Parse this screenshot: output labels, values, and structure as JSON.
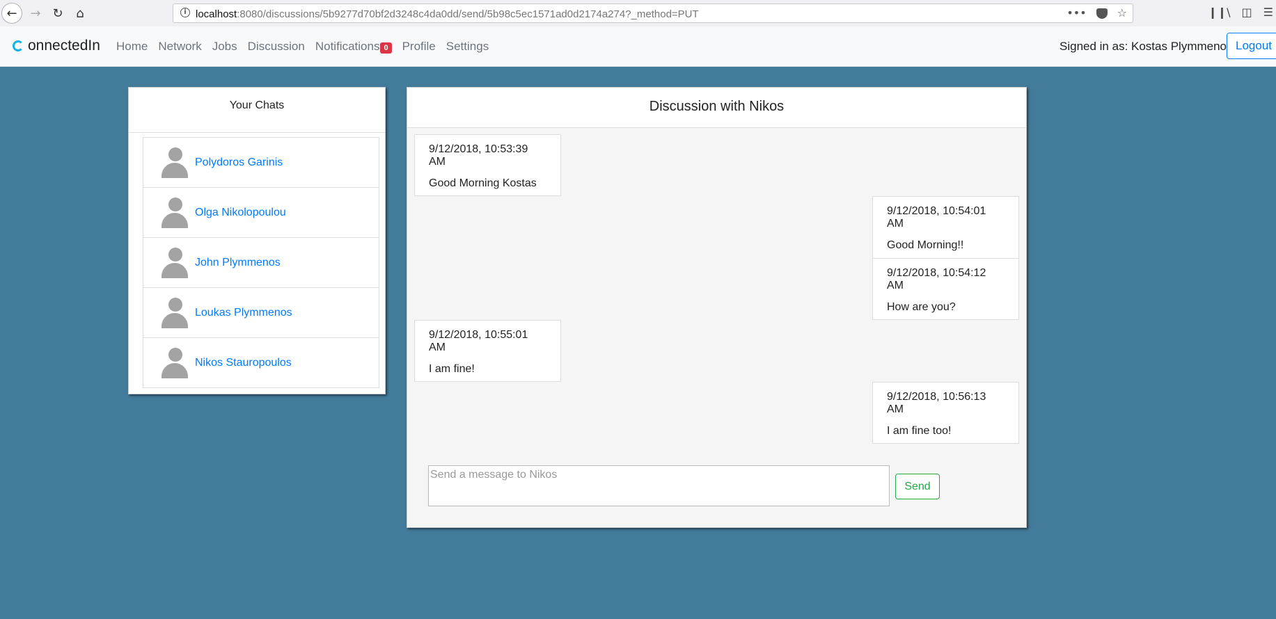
{
  "browser": {
    "url_host": "localhost",
    "url_rest": ":8080/discussions/5b9277d70bf2d3248c4da0dd/send/5b98c5ec1571ad0d2174a274?_method=PUT",
    "menu_dots": "•••",
    "icons": [
      "back-icon",
      "forward-icon",
      "reload-icon",
      "home-icon",
      "info-icon",
      "more-icon",
      "pocket-icon",
      "bookmark-star-icon",
      "library-icon",
      "sidebar-icon",
      "menu-icon"
    ]
  },
  "navbar": {
    "brand": "onnectedIn",
    "links": [
      "Home",
      "Network",
      "Jobs",
      "Discussion",
      "Notifications",
      "Profile",
      "Settings"
    ],
    "notifications_count": "0",
    "signed_in": "Signed in as: Kostas Plymmenos",
    "logout": "Logout",
    "accent_color": "#17b1e5"
  },
  "chats": {
    "title": "Your Chats",
    "items": [
      {
        "name": "Polydoros Garinis"
      },
      {
        "name": "Olga Nikolopoulou"
      },
      {
        "name": "John Plymmenos"
      },
      {
        "name": "Loukas Plymmenos"
      },
      {
        "name": "Nikos Stauropoulos"
      }
    ]
  },
  "discussion": {
    "title": "Discussion with Nikos",
    "messages": [
      {
        "time": "9/12/2018, 10:53:39 AM",
        "text": "Good Morning Kostas",
        "side": "left"
      },
      {
        "time": "9/12/2018, 10:54:01 AM",
        "text": "Good Morning!!",
        "side": "right"
      },
      {
        "time": "9/12/2018, 10:54:12 AM",
        "text": "How are you?",
        "side": "right"
      },
      {
        "time": "9/12/2018, 10:55:01 AM",
        "text": "I am fine!",
        "side": "left"
      },
      {
        "time": "9/12/2018, 10:56:13 AM",
        "text": "I am fine too!",
        "side": "right"
      }
    ],
    "input_placeholder": "Send a message to Nikos",
    "input_value": "",
    "send_label": "Send"
  }
}
